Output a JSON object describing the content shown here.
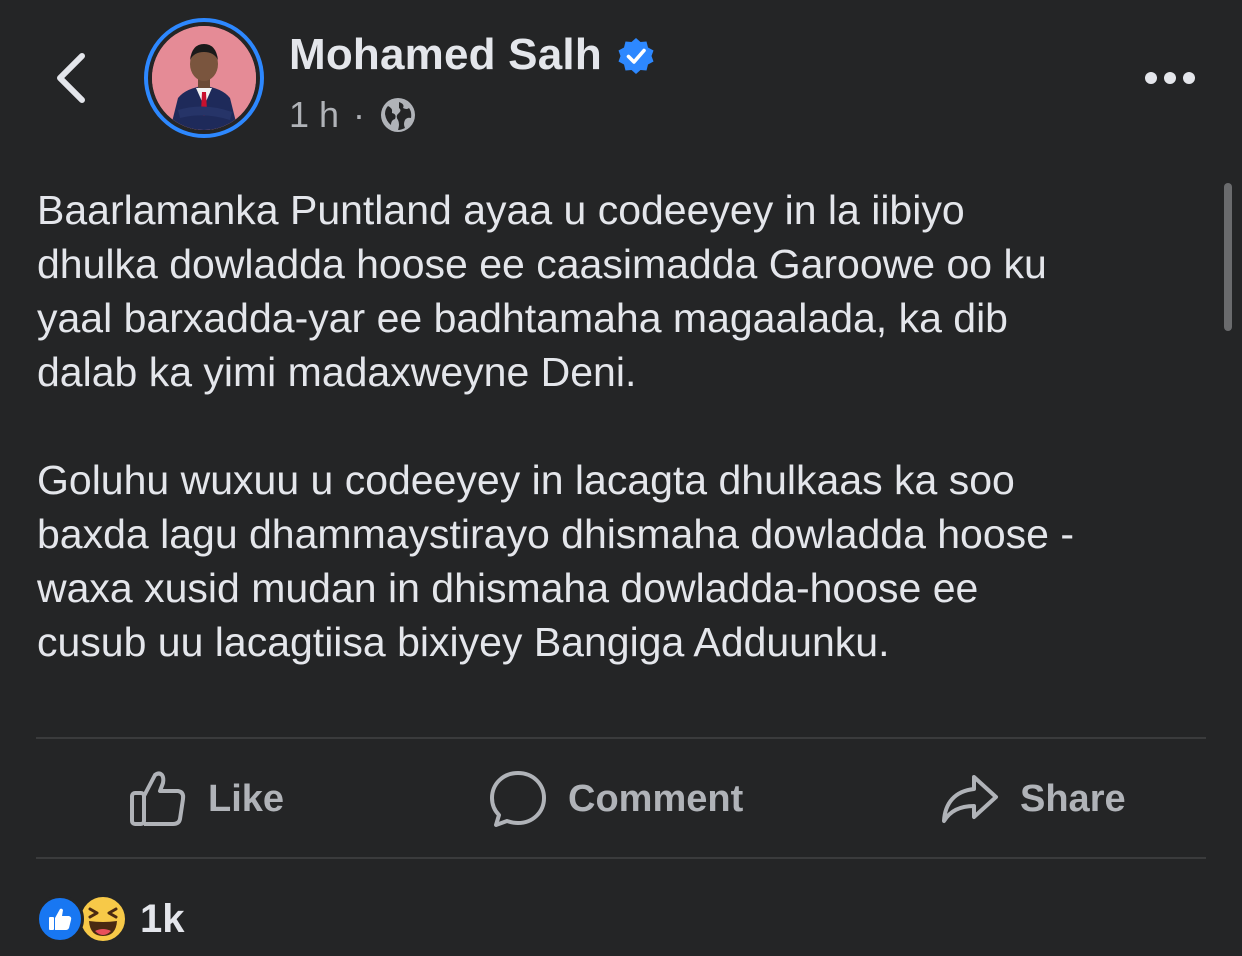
{
  "header": {
    "back_icon": "chevron-left-icon",
    "author_name": "Mohamed Salh",
    "verified_icon": "verified-badge-icon",
    "time": "1 h",
    "separator": "·",
    "audience_icon": "globe-icon",
    "more_icon": "more-horizontal-icon"
  },
  "post": {
    "paragraphs": [
      "Baarlamanka Puntland ayaa u codeeyey in la iibiyo\ndhulka dowladda hoose ee caasimadda Garoowe oo ku\nyaal barxadda-yar ee badhtamaha magaalada, ka dib\ndalab ka yimi madaxweyne Deni.",
      "Goluhu wuxuu u codeeyey in lacagta dhulkaas ka soo\nbaxda lagu dhammaystirayo dhismaha dowladda hoose -\nwaxa xusid mudan in dhismaha dowladda-hoose ee\ncusub uu lacagtiisa bixiyey Bangiga Adduunku."
    ]
  },
  "actions": {
    "like_label": "Like",
    "comment_label": "Comment",
    "share_label": "Share"
  },
  "reactions": {
    "icons": [
      "like-reaction-icon",
      "haha-reaction-icon"
    ],
    "count": "1k"
  },
  "colors": {
    "background": "#242526",
    "primary_text": "#e4e6eb",
    "secondary_text": "#b0b3b8",
    "accent": "#2d88ff",
    "like_blue": "#1877f2"
  }
}
